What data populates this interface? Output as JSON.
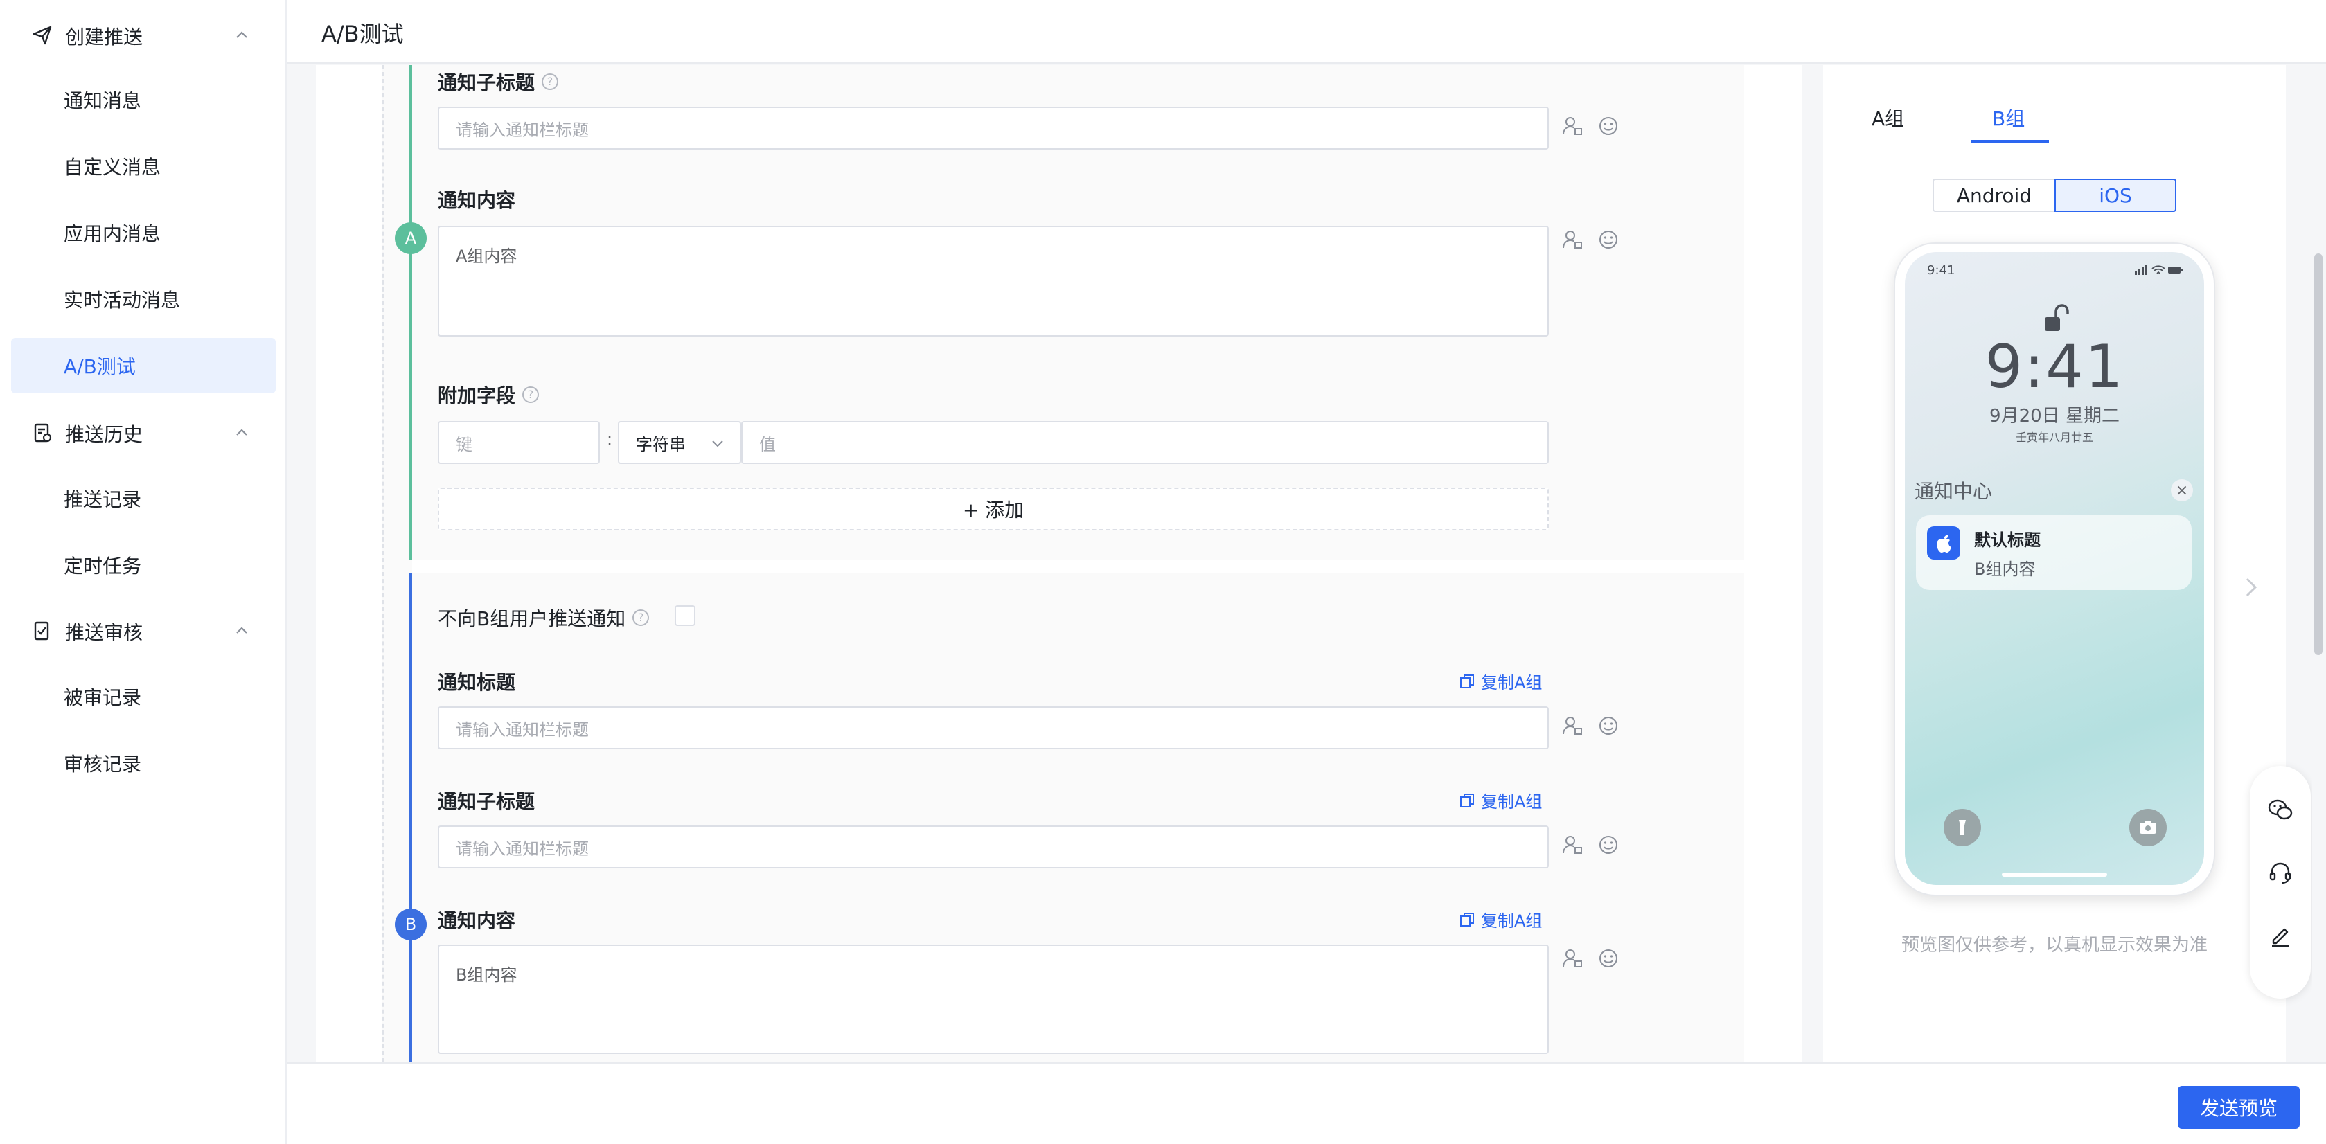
{
  "header": {
    "title": "A/B测试"
  },
  "sidebar": {
    "groups": [
      {
        "label": "创建推送",
        "items": [
          "通知消息",
          "自定义消息",
          "应用内消息",
          "实时活动消息",
          "A/B测试"
        ]
      },
      {
        "label": "推送历史",
        "items": [
          "推送记录",
          "定时任务"
        ]
      },
      {
        "label": "推送审核",
        "items": [
          "被审记录",
          "审核记录"
        ]
      }
    ],
    "active_item": "A/B测试"
  },
  "group_a": {
    "badge": "A",
    "subtitle_label": "通知子标题",
    "subtitle_placeholder": "请输入通知栏标题",
    "content_label": "通知内容",
    "content_value": "A组内容",
    "extra_label": "附加字段",
    "key_placeholder": "键",
    "colon": ":",
    "type_value": "字符串",
    "value_placeholder": "值",
    "add_button": "+ 添加"
  },
  "group_b": {
    "badge": "B",
    "skip_label": "不向B组用户推送通知",
    "title_label": "通知标题",
    "title_placeholder": "请输入通知栏标题",
    "subtitle_label": "通知子标题",
    "subtitle_placeholder": "请输入通知栏标题",
    "content_label": "通知内容",
    "content_value": "B组内容",
    "copy_link": "复制A组"
  },
  "preview": {
    "tabs": [
      "A组",
      "B组"
    ],
    "active_tab": "B组",
    "platforms": [
      "Android",
      "iOS"
    ],
    "active_platform": "iOS",
    "status_time": "9:41",
    "lock_time": "9:41",
    "date": "9月20日 星期二",
    "lunar": "壬寅年八月廿五",
    "nc_title": "通知中心",
    "notification_title": "默认标题",
    "notification_body": "B组内容",
    "note": "预览图仅供参考，以真机显示效果为准"
  },
  "footer": {
    "send_preview": "发送预览"
  },
  "colors": {
    "accent": "#2c66f0",
    "group_a": "#5cbf9c",
    "group_b": "#3b6fe0"
  }
}
